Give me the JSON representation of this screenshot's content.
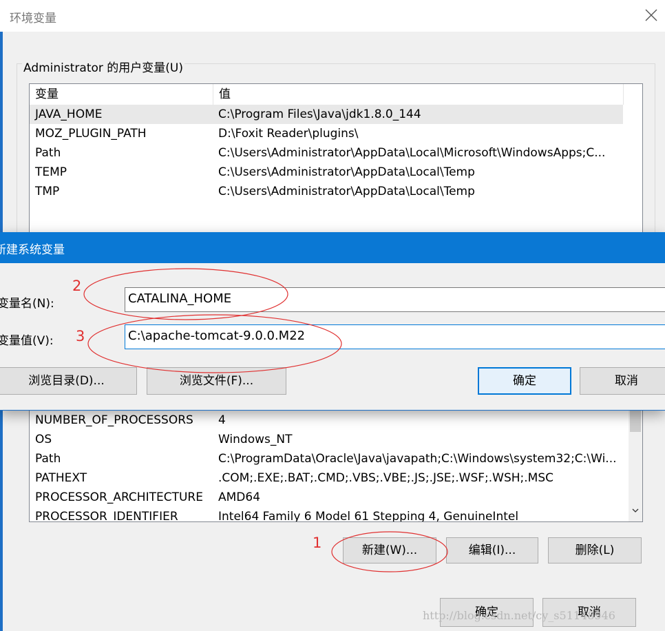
{
  "outer_window": {
    "title": "环境变量",
    "user_group_label": "Administrator 的用户变量(U)",
    "user_columns": [
      "变量",
      "值"
    ],
    "user_vars": [
      {
        "name": "JAVA_HOME",
        "value": "C:\\Program Files\\Java\\jdk1.8.0_144"
      },
      {
        "name": "MOZ_PLUGIN_PATH",
        "value": "D:\\Foxit Reader\\plugins\\"
      },
      {
        "name": "Path",
        "value": "C:\\Users\\Administrator\\AppData\\Local\\Microsoft\\WindowsApps;C..."
      },
      {
        "name": "TEMP",
        "value": "C:\\Users\\Administrator\\AppData\\Local\\Temp"
      },
      {
        "name": "TMP",
        "value": "C:\\Users\\Administrator\\AppData\\Local\\Temp"
      }
    ],
    "system_vars": [
      {
        "name": "NUMBER_OF_PROCESSORS",
        "value": "4"
      },
      {
        "name": "OS",
        "value": "Windows_NT"
      },
      {
        "name": "Path",
        "value": "C:\\ProgramData\\Oracle\\Java\\javapath;C:\\Windows\\system32;C:\\Wi..."
      },
      {
        "name": "PATHEXT",
        "value": ".COM;.EXE;.BAT;.CMD;.VBS;.VBE;.JS;.JSE;.WSF;.WSH;.MSC"
      },
      {
        "name": "PROCESSOR_ARCHITECTURE",
        "value": "AMD64"
      },
      {
        "name": "PROCESSOR_IDENTIFIER",
        "value": "Intel64 Family 6 Model 61 Stepping 4, GenuineIntel"
      }
    ],
    "system_buttons": {
      "new": "新建(W)...",
      "edit": "编辑(I)...",
      "delete": "删除(L)"
    },
    "footer_buttons": {
      "ok": "确定",
      "cancel": "取消"
    }
  },
  "dialog": {
    "title": "新建系统变量",
    "name_label": "变量名(N):",
    "name_value": "CATALINA_HOME",
    "value_label": "变量值(V):",
    "value_value": "C:\\apache-tomcat-9.0.0.M22",
    "browse_dir": "浏览目录(D)...",
    "browse_file": "浏览文件(F)...",
    "ok": "确定",
    "cancel": "取消"
  },
  "annotations": {
    "one": "1",
    "two": "2",
    "three": "3",
    "color": "#e03030"
  },
  "watermark": "http://blog.csdn.net/cy_s51148946",
  "colors": {
    "accent": "#0a78d4"
  }
}
